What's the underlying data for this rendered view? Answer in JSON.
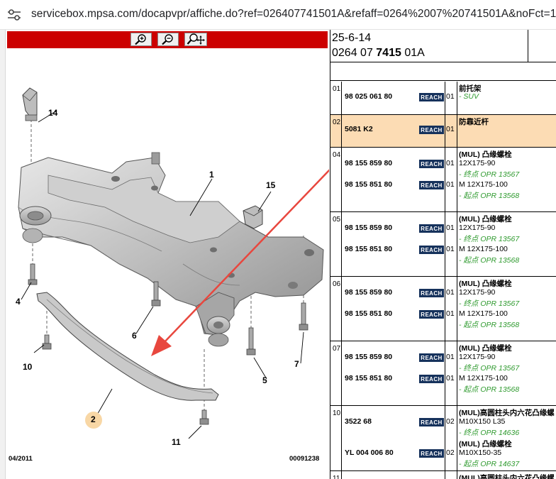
{
  "browser": {
    "url": "servicebox.mpsa.com/docapvpr/affiche.do?ref=026407741501A&refaff=0264%2007%20741501A&noFct=1"
  },
  "drawing": {
    "callouts": {
      "c1": "1",
      "c2": "2",
      "c4": "4",
      "c5": "5",
      "c6": "6",
      "c7": "7",
      "c10": "10",
      "c11": "11",
      "c14": "14",
      "c15": "15"
    },
    "date_code": "04/2011",
    "drawing_number": "00091238"
  },
  "header": {
    "line1": "25-6-14",
    "line2_prefix": "0264 07 ",
    "line2_bold": "7415",
    "line2_suffix": " 01A"
  },
  "reach_label": "REACH",
  "rows": [
    {
      "num": "01",
      "parts": [
        {
          "pn": "98 025 061 80",
          "qty": "01"
        }
      ],
      "desc": [
        {
          "t": "前托架",
          "style": "b"
        },
        {
          "t": "- SUV",
          "style": "g"
        }
      ]
    },
    {
      "num": "02",
      "parts": [
        {
          "pn": "5081 K2",
          "qty": "01"
        }
      ],
      "desc": [
        {
          "t": "防靠近杆",
          "style": "b"
        }
      ]
    },
    {
      "num": "04",
      "parts": [
        {
          "pn": "98 155 859 80",
          "qty": "01"
        },
        {
          "pn": "98 155 851 80",
          "qty": "01"
        }
      ],
      "desc": [
        {
          "t": "(MUL) 凸缘螺栓",
          "style": "b"
        },
        {
          "t": "12X175-90",
          "style": "n"
        },
        {
          "t": "- 终点 OPR 13567",
          "style": "g"
        },
        {
          "t": "M 12X175-100",
          "style": "n"
        },
        {
          "t": "- 起点 OPR 13568",
          "style": "g"
        }
      ]
    },
    {
      "num": "05",
      "parts": [
        {
          "pn": "98 155 859 80",
          "qty": "01"
        },
        {
          "pn": "98 155 851 80",
          "qty": "01"
        }
      ],
      "desc": [
        {
          "t": "(MUL) 凸缘螺栓",
          "style": "b"
        },
        {
          "t": "12X175-90",
          "style": "n"
        },
        {
          "t": "- 终点 OPR 13567",
          "style": "g"
        },
        {
          "t": "M 12X175-100",
          "style": "n"
        },
        {
          "t": "- 起点 OPR 13568",
          "style": "g"
        }
      ]
    },
    {
      "num": "06",
      "parts": [
        {
          "pn": "98 155 859 80",
          "qty": "01"
        },
        {
          "pn": "98 155 851 80",
          "qty": "01"
        }
      ],
      "desc": [
        {
          "t": "(MUL) 凸缘螺栓",
          "style": "b"
        },
        {
          "t": "12X175-90",
          "style": "n"
        },
        {
          "t": "- 终点 OPR 13567",
          "style": "g"
        },
        {
          "t": "M 12X175-100",
          "style": "n"
        },
        {
          "t": "- 起点 OPR 13568",
          "style": "g"
        }
      ]
    },
    {
      "num": "07",
      "parts": [
        {
          "pn": "98 155 859 80",
          "qty": "01"
        },
        {
          "pn": "98 155 851 80",
          "qty": "01"
        }
      ],
      "desc": [
        {
          "t": "(MUL) 凸缘螺栓",
          "style": "b"
        },
        {
          "t": "12X175-90",
          "style": "n"
        },
        {
          "t": "- 终点 OPR 13567",
          "style": "g"
        },
        {
          "t": "M 12X175-100",
          "style": "n"
        },
        {
          "t": "- 起点 OPR 13568",
          "style": "g"
        }
      ]
    },
    {
      "num": "10",
      "parts": [
        {
          "pn": "3522 68",
          "qty": "02"
        },
        {
          "pn": "YL 004 006 80",
          "qty": "02"
        }
      ],
      "desc": [
        {
          "t": "(MUL)高圆柱头内六花凸缘螺",
          "style": "b"
        },
        {
          "t": "M10X150 L35",
          "style": "n"
        },
        {
          "t": "- 终点 OPR 14636",
          "style": "g"
        },
        {
          "t": "(MUL) 凸缘螺栓",
          "style": "b"
        },
        {
          "t": "M10X150-35",
          "style": "n"
        },
        {
          "t": "- 起点 OPR 14637",
          "style": "g"
        }
      ]
    },
    {
      "num": "11",
      "parts": [],
      "desc": [
        {
          "t": "(MUL)高圆柱头内六花凸缘螺",
          "style": "b"
        }
      ]
    }
  ],
  "colors": {
    "toolbar_red": "#cc0000",
    "highlight_row": "#fcdcb4",
    "reach_badge": "#16325c",
    "green_note": "#2e9a2e",
    "arrow_red": "#e8473e"
  },
  "icons": {
    "zoom_in": "zoom-in-icon",
    "zoom_out": "zoom-out-icon",
    "zoom_fit": "zoom-fit-icon",
    "site_settings": "site-settings-icon"
  }
}
